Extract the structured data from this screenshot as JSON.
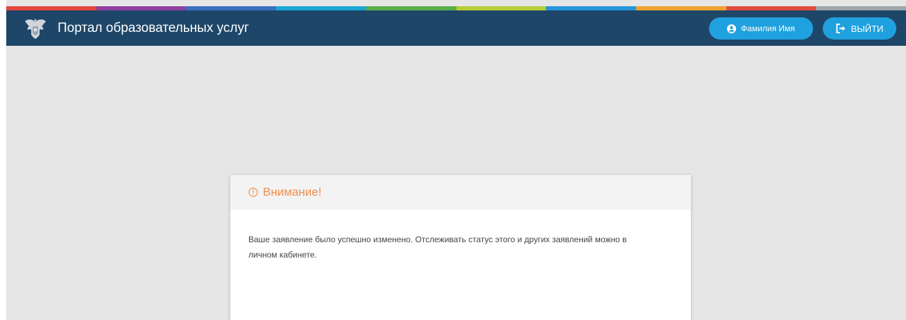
{
  "header": {
    "title": "Портал образовательных услуг",
    "emblem_icon": "coat-of-arms-icon",
    "stripe_colors": [
      "#e2463f",
      "#8e3fa0",
      "#3a6fc2",
      "#1ba6d6",
      "#58b04a",
      "#b7cd34",
      "#2596d8",
      "#f0a130",
      "#e04a40",
      "#9ea6ab"
    ],
    "user_button": {
      "label": "Фамилия Имя",
      "icon": "user-circle-icon"
    },
    "logout_button": {
      "label": "ВЫЙТИ",
      "icon": "sign-out-icon"
    }
  },
  "dialog": {
    "icon": "alert-circle-icon",
    "title": "Внимание!",
    "message": "Ваше заявление было успешно изменено. Отслеживать статус этого и других заявлений можно в личном кабинете."
  },
  "colors": {
    "header_bg": "#1e4668",
    "button_bg": "#1fa1df",
    "warning": "#ef8f4e",
    "page_bg": "#e6e6e6"
  }
}
